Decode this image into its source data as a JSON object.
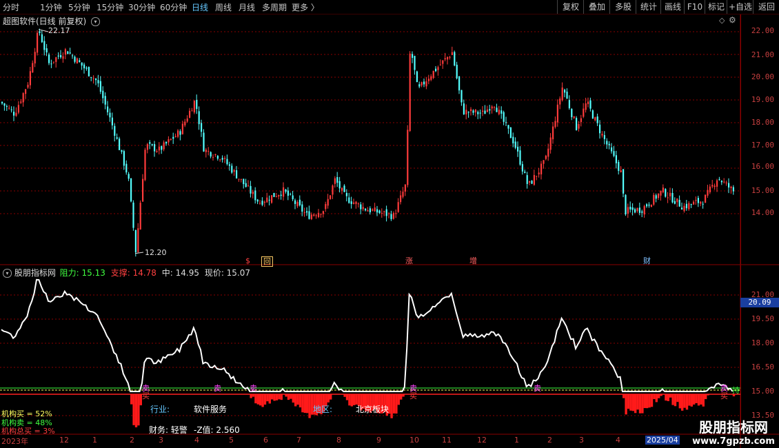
{
  "toolbar": {
    "periods": [
      "分时",
      "1分钟",
      "5分钟",
      "15分钟",
      "30分钟",
      "60分钟",
      "日线",
      "周线",
      "月线",
      "多周期",
      "更多 〉"
    ],
    "active_period": "日线",
    "right_buttons": [
      "复权",
      "叠加",
      "多股",
      "统计",
      "画线",
      "F10",
      "标记",
      "+自选",
      "返回"
    ]
  },
  "main_chart": {
    "title": "超图软件(日线 前复权)",
    "high_label": "22.17",
    "low_label": "12.20",
    "y_ticks": [
      "22.00",
      "21.00",
      "20.00",
      "19.00",
      "18.00",
      "17.00",
      "16.00",
      "15.00",
      "14.00"
    ],
    "event_badges": [
      {
        "text": "$",
        "color": "#ff4040"
      },
      {
        "text": "回",
        "color": "#ffcc66"
      },
      {
        "text": "涨",
        "color": "#ff6060"
      },
      {
        "text": "增",
        "color": "#ff6060"
      },
      {
        "text": "财",
        "color": "#80c0ff"
      }
    ],
    "colors": {
      "up": "#ff3b3b",
      "down": "#54ffff",
      "grid": "#8b0000"
    }
  },
  "indicator": {
    "name": "股朋指标网",
    "resist_label": "阻力: 15.13",
    "support_label": "支撑: 14.78",
    "mid_label": "中: 14.95",
    "price_label": "现价: 15.07",
    "y_ticks": [
      "21.00",
      "19.50",
      "18.00",
      "16.50",
      "15.00",
      "13.50"
    ],
    "current_value": "20.09",
    "industry_label": "行业:",
    "industry_value": "软件服务",
    "region_label": "地区:",
    "region_value": "北京板块",
    "finance_label": "财务: 轻警",
    "zvalue_label": "-Z值: 2.560",
    "legend": [
      {
        "text": "机构买 = 52%",
        "color": "#ffff60"
      },
      {
        "text": "机构卖 = 48%",
        "color": "#40ff40"
      },
      {
        "text": "机构总买 = 3%",
        "color": "#ff4040"
      }
    ],
    "signal_sell": "卖",
    "signal_buy": "买",
    "signal_hold": "持"
  },
  "x_axis": {
    "labels": [
      "2023年",
      "12",
      "1",
      "2",
      "3",
      "4",
      "5",
      "6",
      "7",
      "8",
      "9",
      "10",
      "11",
      "12",
      "1",
      "2",
      "3",
      "4",
      "2025/04"
    ]
  },
  "watermark": {
    "line1": "股朋指标网",
    "line2": "www.7gpzb.com"
  }
}
